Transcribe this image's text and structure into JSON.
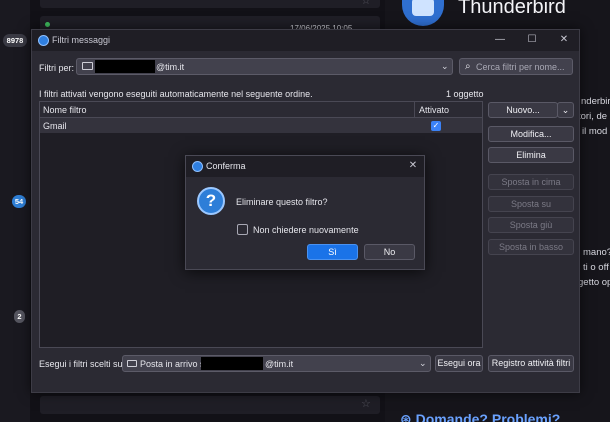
{
  "background": {
    "badges": [
      "8978",
      "54",
      "2"
    ],
    "date_text": "17/06/2025 10:05",
    "app_title": "Thunderbird",
    "snippets": [
      "nderbir",
      "tori, de",
      "il mod",
      "mano?",
      "ti o off",
      "getto op"
    ],
    "faq_text": "Domande? Problemi?"
  },
  "filter_dialog": {
    "title": "Filtri messaggi",
    "filters_for_label": "Filtri per:",
    "account_suffix": "@tim.it",
    "search_placeholder": "Cerca filtri per nome...",
    "description": "I filtri attivati vengono eseguiti automaticamente nel seguente ordine.",
    "count": "1 oggetto",
    "columns": {
      "name": "Nome filtro",
      "enabled": "Attivato"
    },
    "rows": [
      {
        "name": "Gmail",
        "enabled": true
      }
    ],
    "buttons": {
      "new": "Nuovo...",
      "edit": "Modifica...",
      "delete": "Elimina",
      "move_top": "Sposta in cima",
      "move_up": "Sposta su",
      "move_down": "Sposta giù",
      "move_bottom": "Sposta in basso",
      "run_now": "Esegui ora",
      "activity_log": "Registro attività filtri"
    },
    "run_label": "Esegui i filtri scelti su:",
    "folder_prefix": "Posta in arrivo su",
    "folder_suffix": "@tim.it"
  },
  "confirm_dialog": {
    "title": "Conferma",
    "message": "Eliminare questo filtro?",
    "dont_ask_label": "Non chiedere nuovamente",
    "dont_ask_checked": false,
    "yes_label": "Sì",
    "no_label": "No"
  },
  "colors": {
    "accent": "#1a73e8",
    "dialog_bg": "#2b2a33",
    "titlebar_bg": "#1f1e25"
  }
}
